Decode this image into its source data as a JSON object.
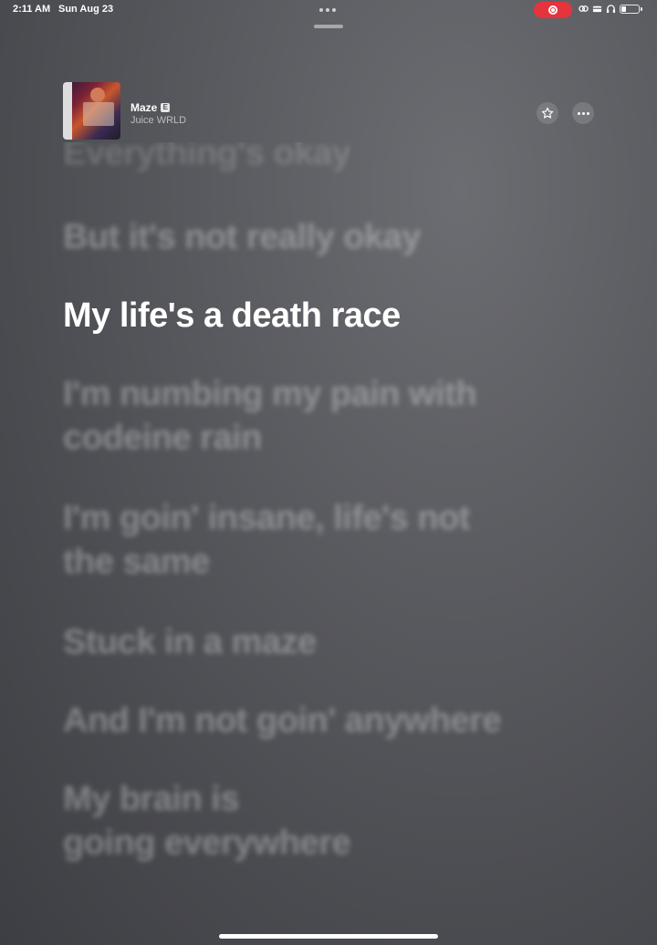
{
  "status_bar": {
    "time": "2:11 AM",
    "date": "Sun Aug 23",
    "battery_level": 0.3,
    "icons": [
      "screen-record-icon",
      "link-icon",
      "card-icon",
      "headphones-icon",
      "battery-icon"
    ],
    "record_color": "#e5343d"
  },
  "now_playing": {
    "title": "Maze",
    "explicit_badge": "E",
    "artist": "Juice WRLD",
    "artwork_icon": "album-artwork"
  },
  "lyrics": {
    "lines": [
      {
        "text": "Everything's okay",
        "state": "past"
      },
      {
        "text": "But it's not really okay",
        "state": "past"
      },
      {
        "text": "My life's a death race",
        "state": "current"
      },
      {
        "text": "I'm numbing my pain with",
        "state": "upcoming"
      },
      {
        "text": "codeine rain",
        "state": "upcoming"
      },
      {
        "text": "I'm goin' insane, life's not",
        "state": "upcoming"
      },
      {
        "text": "the same",
        "state": "upcoming"
      },
      {
        "text": "Stuck in a maze",
        "state": "upcoming"
      },
      {
        "text": "And I'm not goin' anywhere",
        "state": "upcoming"
      },
      {
        "text": "My brain is",
        "state": "upcoming"
      },
      {
        "text": "going everywhere",
        "state": "upcoming"
      }
    ]
  }
}
